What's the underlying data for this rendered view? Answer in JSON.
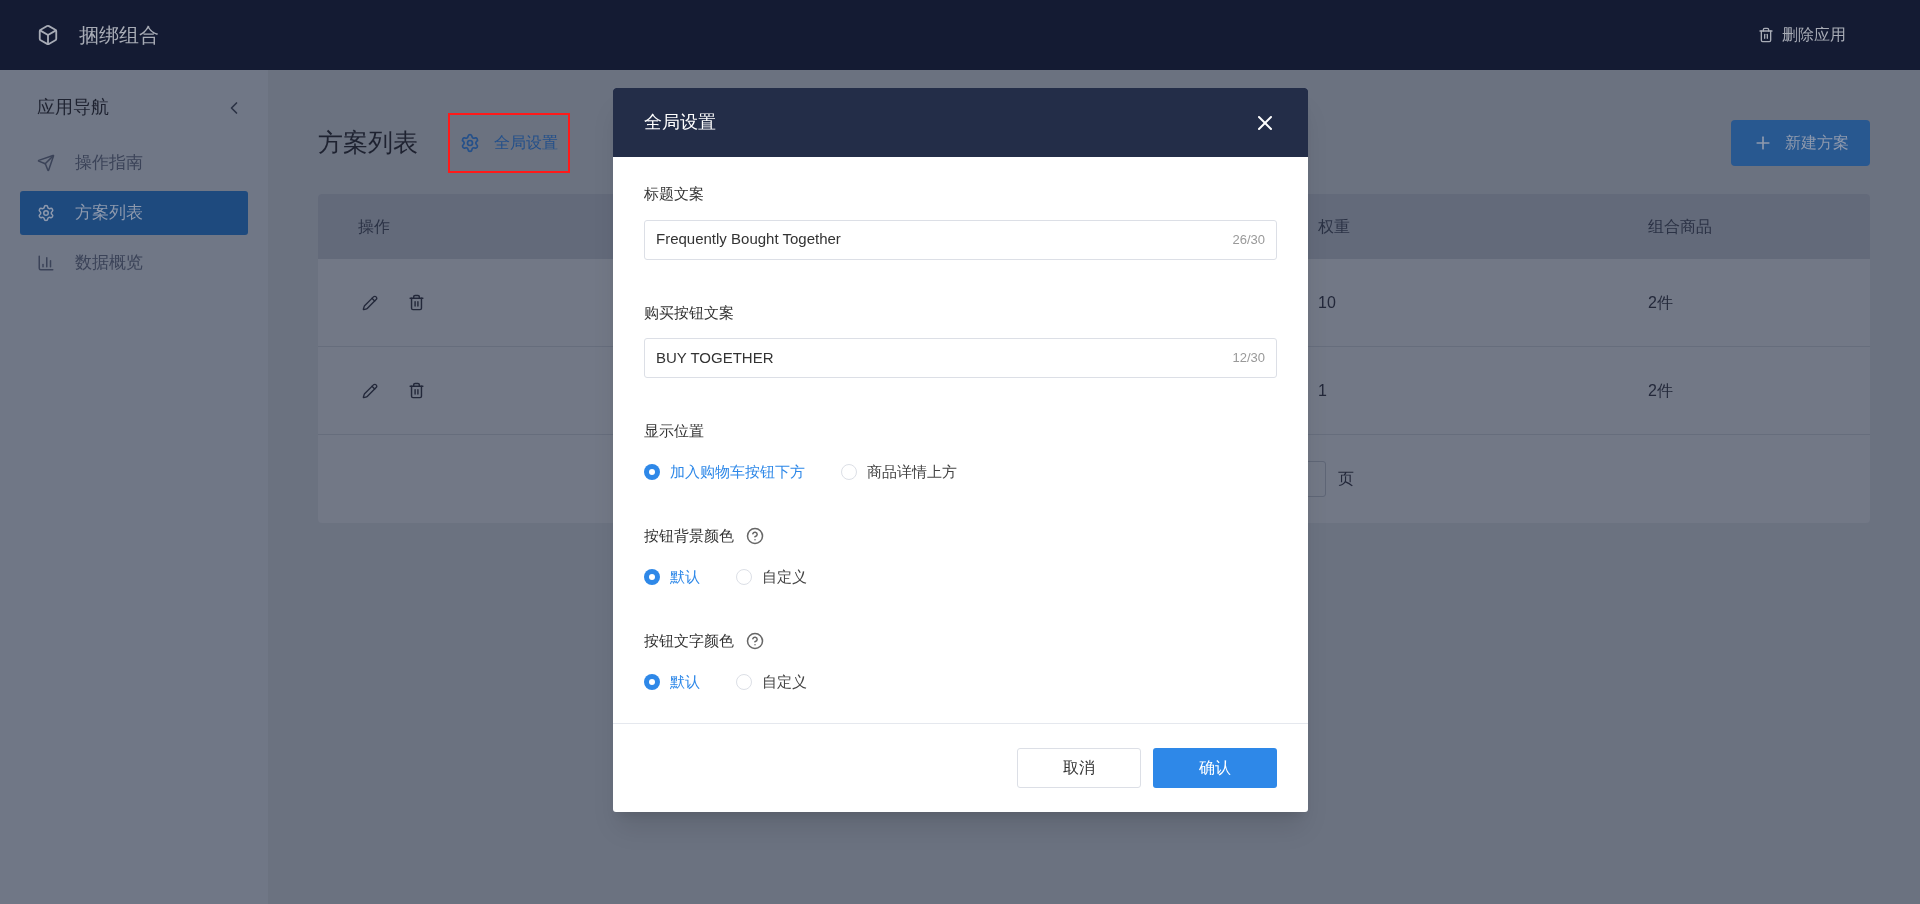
{
  "app": {
    "title": "捆绑组合",
    "delete_label": "删除应用"
  },
  "sidebar": {
    "title": "应用导航",
    "items": [
      {
        "label": "操作指南",
        "selected": false
      },
      {
        "label": "方案列表",
        "selected": true
      },
      {
        "label": "数据概览",
        "selected": false
      }
    ]
  },
  "page": {
    "title": "方案列表",
    "settings_link": "全局设置",
    "new_button": "新建方案"
  },
  "table": {
    "columns": [
      "操作",
      "权重",
      "组合商品"
    ],
    "rows": [
      {
        "weight": "10",
        "items": "2件"
      },
      {
        "weight": "1",
        "items": "2件"
      }
    ],
    "pagination_suffix": "页"
  },
  "modal": {
    "title": "全局设置",
    "fields": [
      {
        "kind": "text",
        "label": "标题文案",
        "value": "Frequently Bought Together",
        "counter": "26/30"
      },
      {
        "kind": "text",
        "label": "购买按钮文案",
        "value": "BUY TOGETHER",
        "counter": "12/30"
      },
      {
        "kind": "radio",
        "label": "显示位置",
        "help": false,
        "options": [
          {
            "label": "加入购物车按钮下方",
            "selected": true
          },
          {
            "label": "商品详情上方",
            "selected": false
          }
        ]
      },
      {
        "kind": "radio",
        "label": "按钮背景颜色",
        "help": true,
        "options": [
          {
            "label": "默认",
            "selected": true
          },
          {
            "label": "自定义",
            "selected": false
          }
        ]
      },
      {
        "kind": "radio",
        "label": "按钮文字颜色",
        "help": true,
        "options": [
          {
            "label": "默认",
            "selected": true
          },
          {
            "label": "自定义",
            "selected": false
          }
        ]
      }
    ],
    "buttons": [
      {
        "label": "取消",
        "kind": "secondary"
      },
      {
        "label": "确认",
        "kind": "primary"
      }
    ]
  }
}
